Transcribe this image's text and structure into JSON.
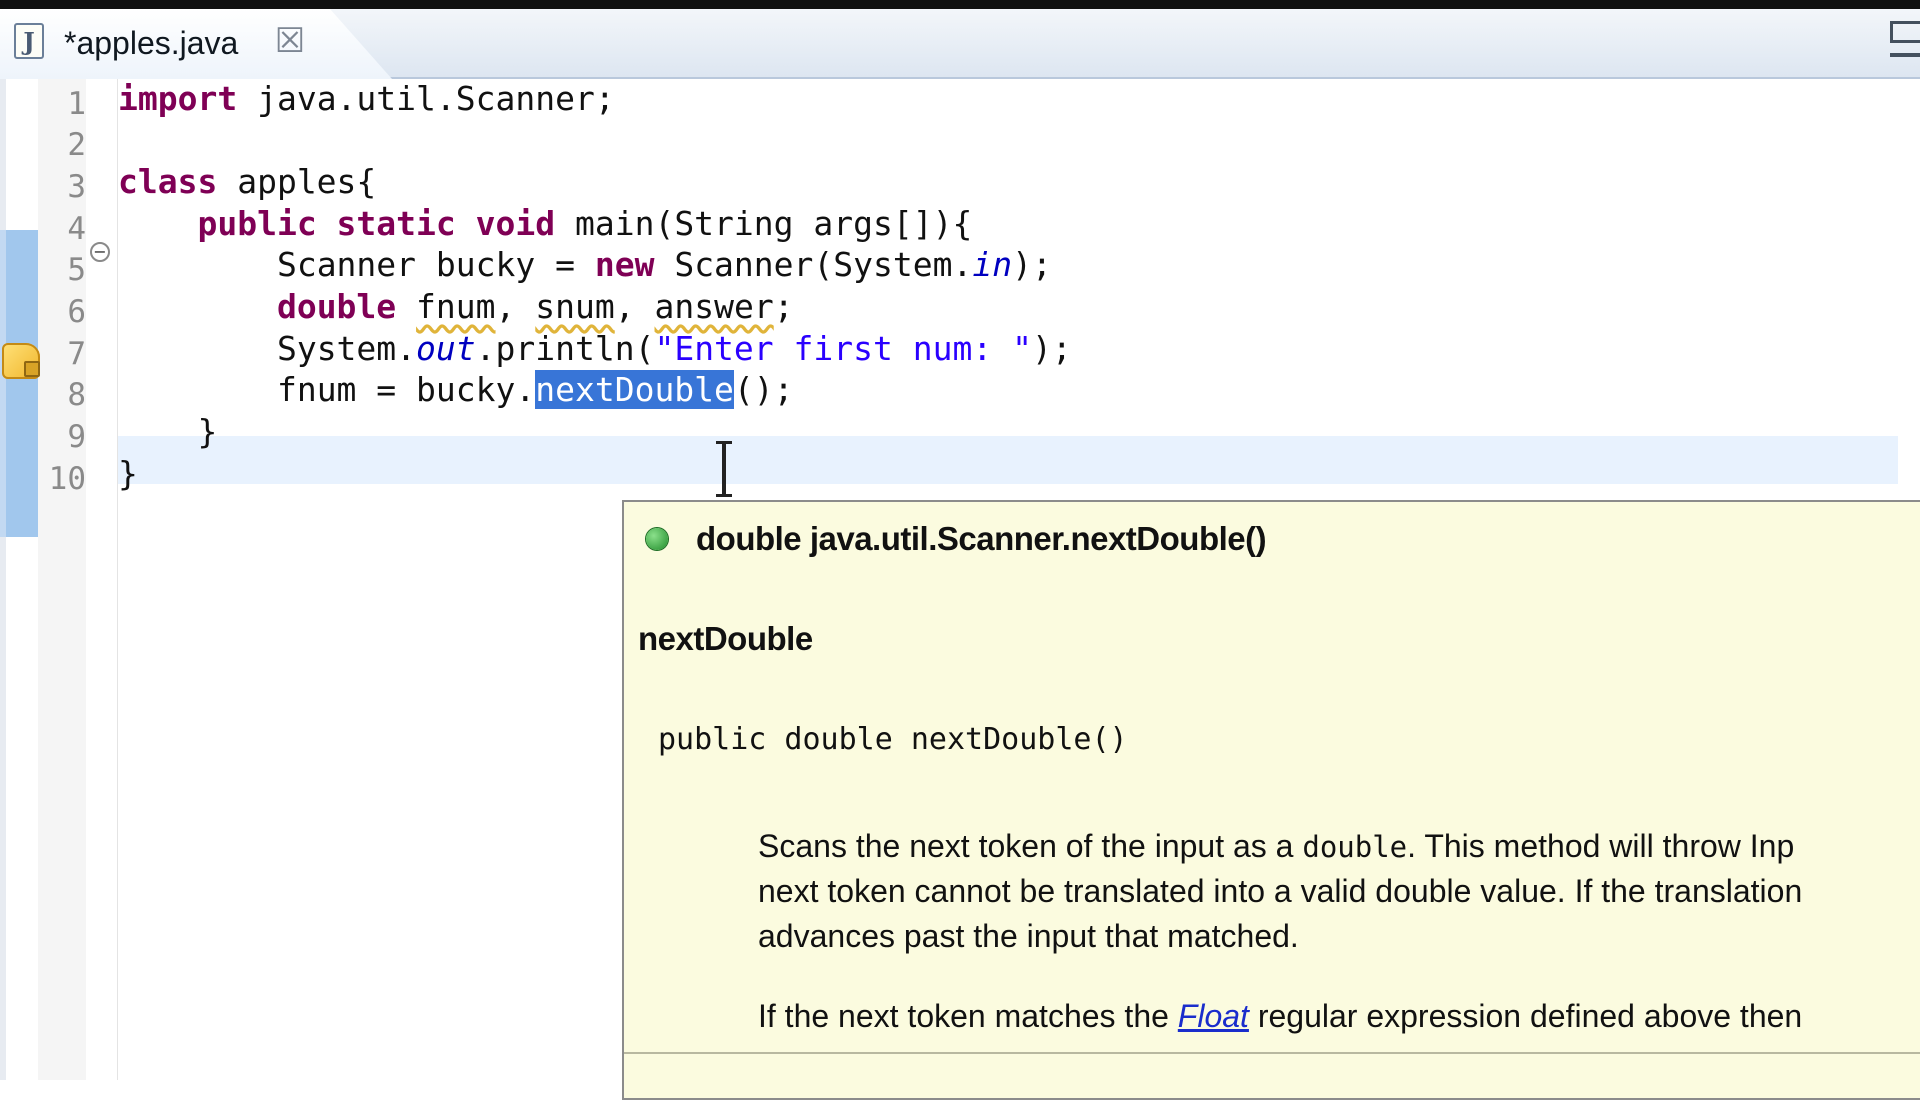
{
  "tab": {
    "icon_letter": "J",
    "title": "*apples.java",
    "close_glyph": "☒"
  },
  "line_numbers": [
    "1",
    "2",
    "3",
    "4",
    "5",
    "6",
    "7",
    "8",
    "9",
    "10"
  ],
  "code": {
    "l1_kw": "import",
    "l1_rest": " java.util.Scanner;",
    "l3_kw": "class",
    "l3_rest": " apples{",
    "l4_indent": "    ",
    "l4_kw": "public static void",
    "l4_rest": " main(String args[]){",
    "l5_indent": "        ",
    "l5_a": "Scanner bucky = ",
    "l5_kw": "new",
    "l5_b": " Scanner(System.",
    "l5_fld": "in",
    "l5_c": ");",
    "l6_indent": "        ",
    "l6_kw": "double",
    "l6_sp": " ",
    "l6_v1": "fnum",
    "l6_c1": ", ",
    "l6_v2": "snum",
    "l6_c2": ", ",
    "l6_v3": "answer",
    "l6_end": ";",
    "l7_indent": "        ",
    "l7_a": "System.",
    "l7_fld": "out",
    "l7_b": ".println(",
    "l7_str": "\"Enter first num: \"",
    "l7_c": ");",
    "l8_indent": "        ",
    "l8_a": "fnum = bucky.",
    "l8_sel": "nextDouble",
    "l8_b": "();",
    "l9": "    }",
    "l10": "}"
  },
  "hover": {
    "signature": "double java.util.Scanner.nextDouble()",
    "method_name": "nextDouble",
    "declaration": "public double nextDouble()",
    "desc_line1_a": "Scans the next token of the input as a ",
    "desc_line1_code": "double",
    "desc_line1_b": ". This method will throw Inp",
    "desc_line2": "next token cannot be translated into a valid double value. If the translation",
    "desc_line3": "advances past the input that matched.",
    "desc2_a": "If the next token matches the ",
    "desc2_link": "Float",
    "desc2_b": " regular expression defined above then"
  }
}
